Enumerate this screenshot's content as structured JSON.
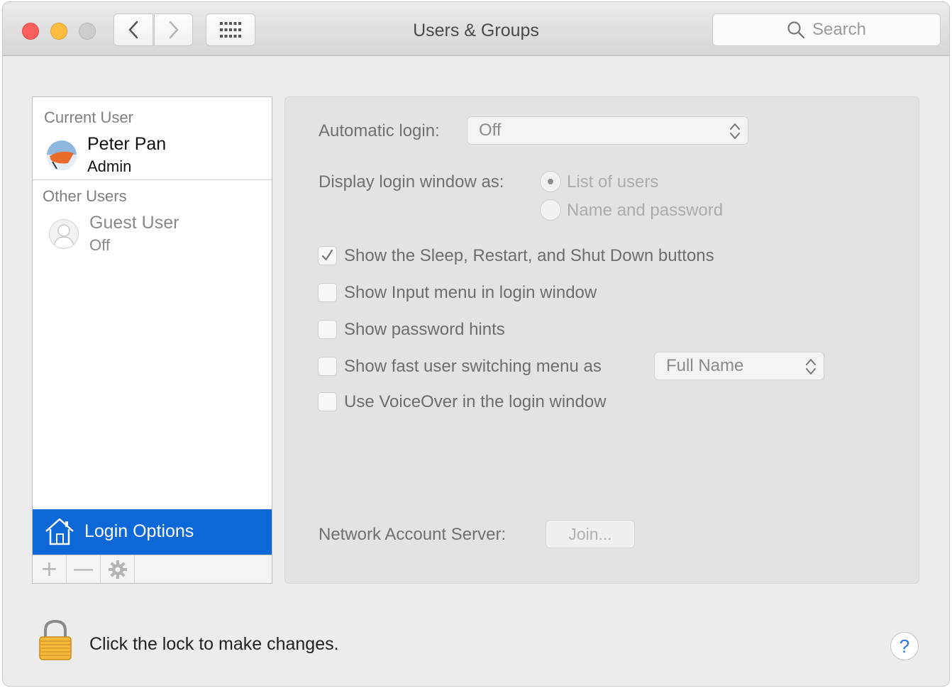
{
  "window": {
    "title": "Users & Groups",
    "search_placeholder": "Search",
    "traffic_lights": [
      "close-button",
      "minimize-button",
      "zoom-button"
    ],
    "colors": {
      "close": "#fc605c",
      "minimize": "#fdbc40",
      "zoom": "#cdcdcd"
    }
  },
  "sidebar": {
    "current_user_label": "Current User",
    "current_user": {
      "name": "Peter Pan",
      "role": "Admin"
    },
    "other_users_label": "Other Users",
    "other_users": [
      {
        "name": "Guest User",
        "status": "Off"
      }
    ],
    "login_options_label": "Login Options",
    "selected_color": "#0e68d8",
    "toolbar": {
      "add": "+",
      "remove": "—",
      "action_icon": "gear-icon"
    }
  },
  "login": {
    "automatic_login_label": "Automatic login:",
    "automatic_login_value": "Off",
    "display_as_label": "Display login window as:",
    "display_options": [
      {
        "label": "List of users",
        "selected": true
      },
      {
        "label": "Name and password",
        "selected": false
      }
    ],
    "checkboxes": [
      {
        "label": "Show the Sleep, Restart, and Shut Down buttons",
        "checked": true
      },
      {
        "label": "Show Input menu in login window",
        "checked": false
      },
      {
        "label": "Show password hints",
        "checked": false
      },
      {
        "label": "Show fast user switching menu as",
        "checked": false
      },
      {
        "label": "Use VoiceOver in the login window",
        "checked": false
      }
    ],
    "fast_switch_value": "Full Name",
    "network_server_label": "Network Account Server:",
    "join_label": "Join..."
  },
  "footer": {
    "lock_text": "Click the lock to make changes.",
    "help_label": "?"
  }
}
